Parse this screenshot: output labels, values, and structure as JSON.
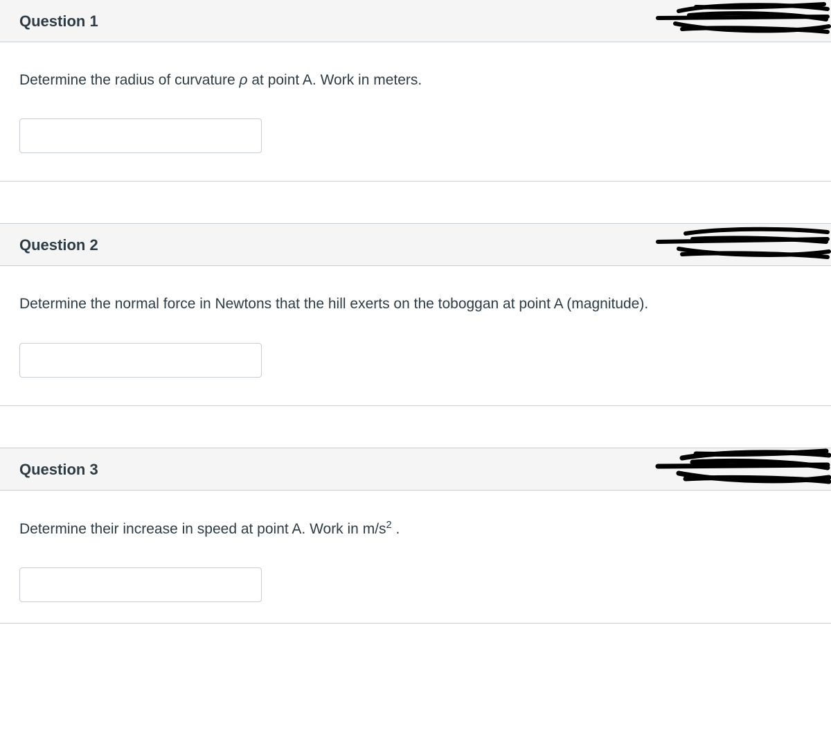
{
  "questions": [
    {
      "title": "Question 1",
      "promptBefore": "Determine the radius of curvature ",
      "italic": "ρ",
      "promptAfter": " at point A.  Work in meters.",
      "inputValue": ""
    },
    {
      "title": "Question 2",
      "promptBefore": "Determine the normal force in Newtons that the hill exerts on the toboggan at point A (magnitude).",
      "italic": "",
      "promptAfter": "",
      "inputValue": ""
    },
    {
      "title": "Question 3",
      "promptBefore": "Determine their increase in speed at point A.  Work in m/s",
      "italic": "",
      "promptAfter": " .",
      "sup": "2",
      "inputValue": ""
    }
  ]
}
